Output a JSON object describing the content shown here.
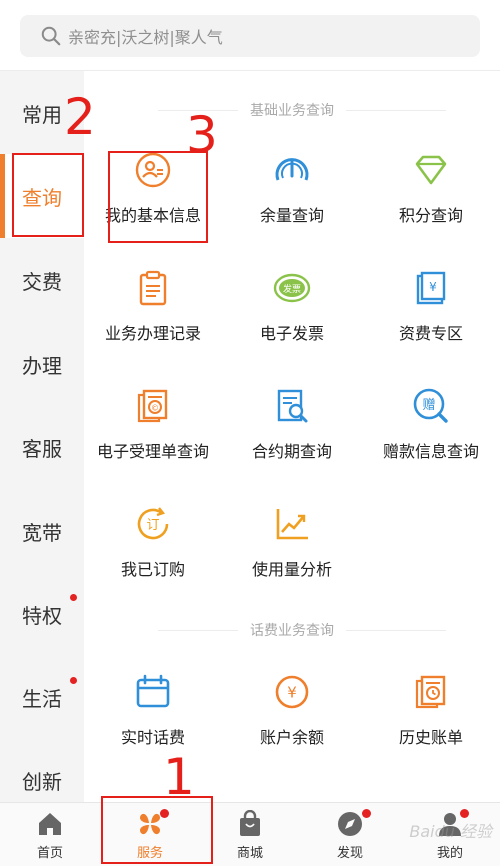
{
  "search": {
    "placeholder": "亲密充|沃之树|聚人气"
  },
  "sidebar": {
    "items": [
      {
        "label": "常用"
      },
      {
        "label": "查询"
      },
      {
        "label": "交费"
      },
      {
        "label": "办理"
      },
      {
        "label": "客服"
      },
      {
        "label": "宽带"
      },
      {
        "label": "特权"
      },
      {
        "label": "生活"
      },
      {
        "label": "创新"
      }
    ],
    "active": "查询"
  },
  "sections": [
    {
      "title": "基础业务查询",
      "items": [
        {
          "label": "我的基本信息",
          "icon": "user-profile-icon"
        },
        {
          "label": "余量查询",
          "icon": "signal-gauge-icon"
        },
        {
          "label": "积分查询",
          "icon": "diamond-icon"
        },
        {
          "label": "业务办理记录",
          "icon": "clipboard-icon"
        },
        {
          "label": "电子发票",
          "icon": "invoice-badge-icon",
          "badge": "发票"
        },
        {
          "label": "资费专区",
          "icon": "yuan-book-icon",
          "badge": "¥"
        },
        {
          "label": "电子受理单查询",
          "icon": "receipt-icon"
        },
        {
          "label": "合约期查询",
          "icon": "document-search-icon"
        },
        {
          "label": "赠款信息查询",
          "icon": "gift-search-icon",
          "badge": "赠"
        },
        {
          "label": "我已订购",
          "icon": "subscribed-icon",
          "badge": "订"
        },
        {
          "label": "使用量分析",
          "icon": "trend-chart-icon"
        }
      ]
    },
    {
      "title": "话费业务查询",
      "items": [
        {
          "label": "实时话费",
          "icon": "calendar-icon"
        },
        {
          "label": "账户余额",
          "icon": "yuan-coin-icon",
          "badge": "¥"
        },
        {
          "label": "历史账单",
          "icon": "history-bill-icon"
        }
      ]
    }
  ],
  "bottom_nav": {
    "items": [
      {
        "label": "首页",
        "icon": "home-icon"
      },
      {
        "label": "服务",
        "icon": "service-icon"
      },
      {
        "label": "商城",
        "icon": "shopping-bag-icon"
      },
      {
        "label": "发现",
        "icon": "compass-icon"
      },
      {
        "label": "我的",
        "icon": "user-icon"
      }
    ],
    "active": "服务"
  },
  "annotations": [
    "1",
    "2",
    "3"
  ],
  "watermark": "Baidu 经验",
  "colors": {
    "accent": "#ef7f2c",
    "badge_red": "#e42222",
    "annotation": "#e5201a",
    "green": "#8bc34a",
    "blue": "#2f8fd8"
  }
}
